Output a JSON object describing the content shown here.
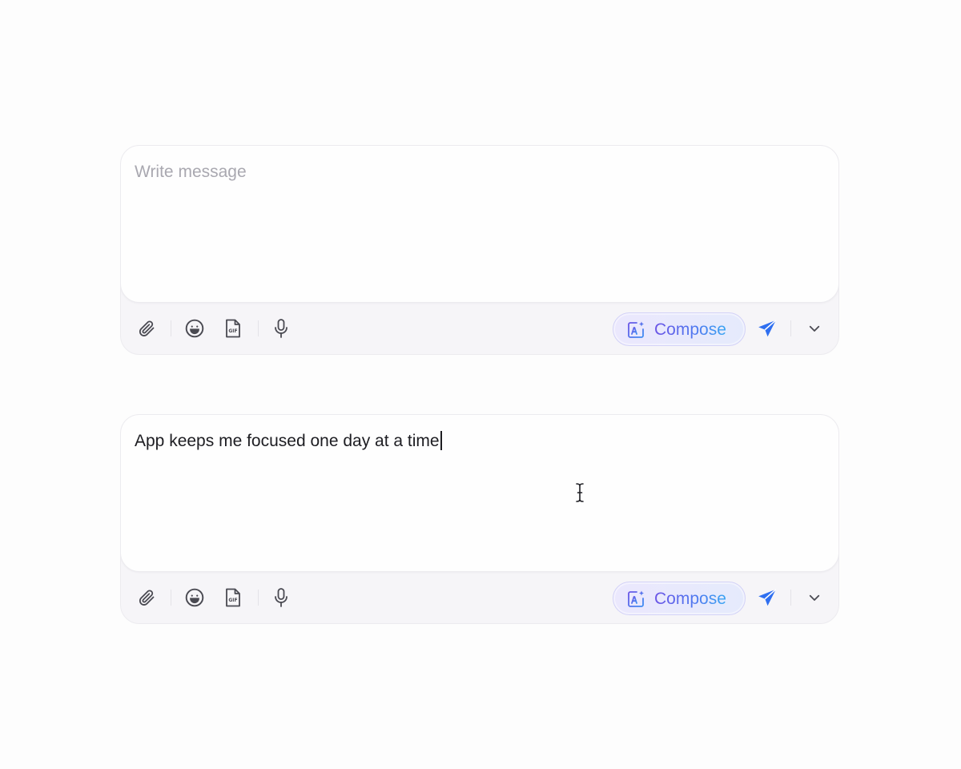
{
  "composers": [
    {
      "state": "empty",
      "placeholder": "Write message",
      "value": "",
      "compose_label": "Compose"
    },
    {
      "state": "typed",
      "placeholder": "Write message",
      "value": "App keeps me focused one day at a time",
      "compose_label": "Compose"
    }
  ],
  "toolbar_icons": [
    "paperclip-icon",
    "emoji-icon",
    "gif-file-icon",
    "microphone-icon",
    "ai-sparkle-icon",
    "send-icon",
    "chevron-down-icon"
  ],
  "colors": {
    "accent": "#2f6ff0",
    "compose_gradient_start": "#6b54e6",
    "compose_gradient_end": "#3aa6f2",
    "icon": "#4a4a52"
  }
}
